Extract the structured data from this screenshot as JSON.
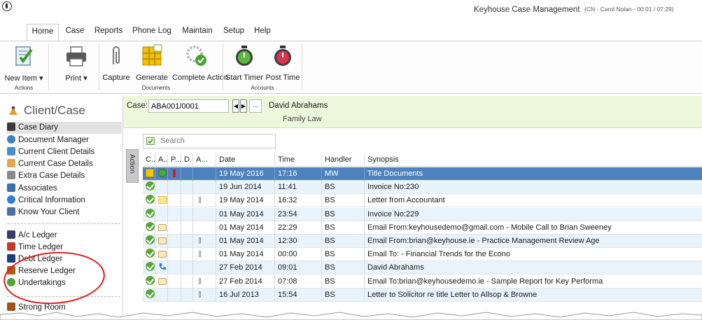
{
  "window": {
    "title": "Keyhouse Case Management",
    "user_info": "(CN - Carol Nolan - 00:01 / 07:29)"
  },
  "menu": {
    "tabs": [
      "Home",
      "Case",
      "Reports",
      "Phone Log",
      "Maintain",
      "Setup",
      "Help"
    ],
    "active": "Home"
  },
  "ribbon": {
    "buttons": {
      "new_item": "New Item ▾",
      "print": "Print ▾",
      "capture": "Capture",
      "generate": "Generate",
      "complete_action": "Complete Action",
      "start_timer": "Start Timer",
      "post_time": "Post Time"
    },
    "groups": {
      "actions": "Actions",
      "documents": "Documents",
      "accounts": "Accounts"
    }
  },
  "nav": {
    "heading": "Client/Case",
    "items": [
      {
        "label": "Case Diary",
        "icon": "diary-icon",
        "color": "#3a3a3a"
      },
      {
        "label": "Document Manager",
        "icon": "document-manager-icon",
        "color": "#3f7fbf"
      },
      {
        "label": "Current Client Details",
        "icon": "client-icon",
        "color": "#4a90c8"
      },
      {
        "label": "Current Case Details",
        "icon": "case-details-icon",
        "color": "#e8a64a"
      },
      {
        "label": "Extra Case Details",
        "icon": "extra-details-icon",
        "color": "#8a8a8a"
      },
      {
        "label": "Associates",
        "icon": "associates-icon",
        "color": "#3d6fb0"
      },
      {
        "label": "Critical Information",
        "icon": "info-icon",
        "color": "#2f7fd1"
      },
      {
        "label": "Know Your Client",
        "icon": "kyc-icon",
        "color": "#4a6fa0"
      },
      {
        "label": "A/c Ledger",
        "icon": "ac-ledger-icon",
        "color": "#3c3c6a"
      },
      {
        "label": "Time Ledger",
        "icon": "time-ledger-icon",
        "color": "#c0392b"
      },
      {
        "label": "Debt Ledger",
        "icon": "debt-ledger-icon",
        "color": "#1f3f7a"
      },
      {
        "label": "Reserve Ledger",
        "icon": "reserve-ledger-icon",
        "color": "#b05a1a"
      },
      {
        "label": "Undertakings",
        "icon": "undertakings-icon",
        "color": "#4da637"
      },
      {
        "label": "Strong Room",
        "icon": "strong-room-icon",
        "color": "#a0521d"
      }
    ]
  },
  "case": {
    "label": "Case:",
    "value": "ABA001/0001",
    "more_button": "...",
    "client_name": "David Abrahams",
    "case_type": "Family Law"
  },
  "action_tab": "Action",
  "search": {
    "placeholder": "Search"
  },
  "grid": {
    "columns": [
      "C...",
      "A...",
      "P...",
      "D..",
      "A...",
      "Date",
      "Time",
      "Handler",
      "Synopsis"
    ],
    "rows": [
      {
        "c": "grid",
        "a": "timer",
        "p": "priority",
        "d": "",
        "att": "",
        "date": "19 May 2016",
        "time": "17:16",
        "handler": "MW",
        "synopsis": "Title Documents",
        "selected": true
      },
      {
        "c": "check",
        "a": "",
        "p": "",
        "d": "",
        "att": "",
        "date": "19 Jun 2014",
        "time": "11:41",
        "handler": "BS",
        "synopsis": "Invoice No:230"
      },
      {
        "c": "check",
        "a": "note",
        "p": "",
        "d": "",
        "att": "clip",
        "date": "19 May 2014",
        "time": "16:32",
        "handler": "BS",
        "synopsis": "Letter from Accountant"
      },
      {
        "c": "check",
        "a": "",
        "p": "",
        "d": "",
        "att": "",
        "date": "01 May 2014",
        "time": "23:54",
        "handler": "BS",
        "synopsis": "Invoice No:229"
      },
      {
        "c": "check",
        "a": "email",
        "p": "",
        "d": "",
        "att": "",
        "date": "01 May 2014",
        "time": "22:29",
        "handler": "BS",
        "synopsis": "Email From:keyhousedemo@gmail.com - Mobile Call to Brian Sweeney"
      },
      {
        "c": "check",
        "a": "email",
        "p": "",
        "d": "",
        "att": "clip",
        "date": "01 May 2014",
        "time": "12:30",
        "handler": "BS",
        "synopsis": "Email From:brian@keyhouse.ie - Practice Management Review Age"
      },
      {
        "c": "check",
        "a": "email",
        "p": "",
        "d": "",
        "att": "clip",
        "date": "01 May 2014",
        "time": "00:00",
        "handler": "BS",
        "synopsis": "Email To: - Financial Trends for the Econo"
      },
      {
        "c": "check",
        "a": "phone",
        "p": "",
        "d": "",
        "att": "",
        "date": "27 Feb 2014",
        "time": "09:01",
        "handler": "BS",
        "synopsis": "David Abrahams"
      },
      {
        "c": "check",
        "a": "email",
        "p": "",
        "d": "",
        "att": "clip",
        "date": "27 Feb 2014",
        "time": "07:08",
        "handler": "BS",
        "synopsis": "Email To:brian@keyhousedemo.ie - Sample Report for Key Performa"
      },
      {
        "c": "check",
        "a": "",
        "p": "",
        "d": "",
        "att": "clip",
        "date": "16 Jul 2013",
        "time": "15:54",
        "handler": "BS",
        "synopsis": "Letter to Solicitor re title Letter to Allsop & Browne"
      }
    ]
  }
}
